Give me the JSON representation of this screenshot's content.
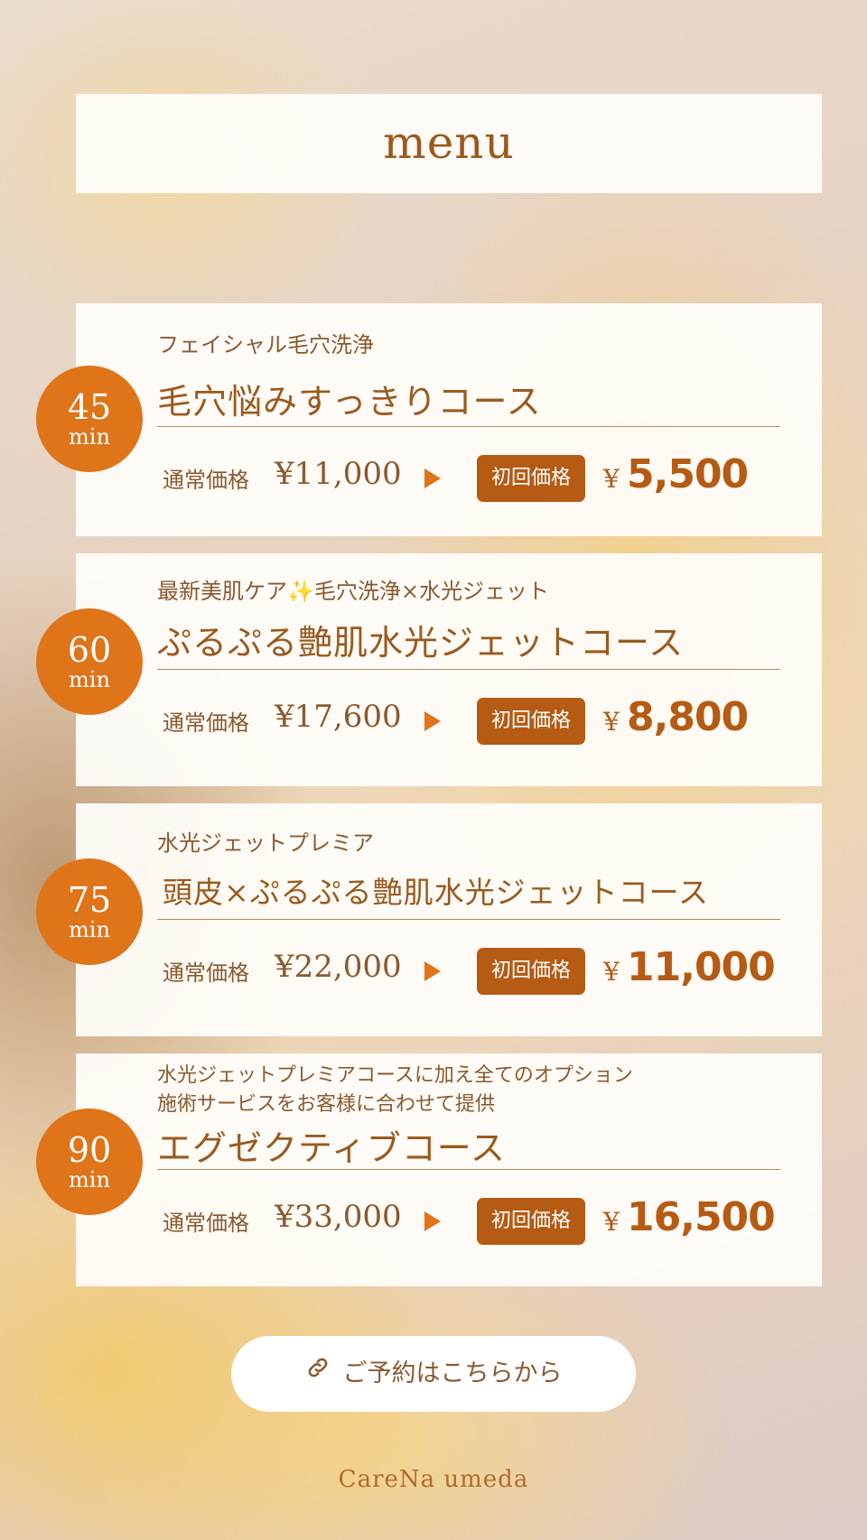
{
  "header": {
    "title": "menu"
  },
  "common": {
    "regular_label": "通常価格",
    "first_label": "初回価格",
    "yen": "¥"
  },
  "courses": [
    {
      "minutes": "45",
      "unit": "min",
      "subtitle": "フェイシャル毛穴洗浄",
      "name": "毛穴悩みすっきりコース",
      "regular_price": "¥11,000",
      "first_price": "5,500"
    },
    {
      "minutes": "60",
      "unit": "min",
      "subtitle": "最新美肌ケア✨毛穴洗浄×水光ジェット",
      "name": "ぷるぷる艶肌水光ジェットコース",
      "regular_price": "¥17,600",
      "first_price": "8,800"
    },
    {
      "minutes": "75",
      "unit": "min",
      "subtitle": "水光ジェットプレミア",
      "name": "頭皮×ぷるぷる艶肌水光ジェットコース",
      "regular_price": "¥22,000",
      "first_price": "11,000"
    },
    {
      "minutes": "90",
      "unit": "min",
      "subtitle": "水光ジェットプレミアコースに加え全てのオプション",
      "subtitle_line2": "施術サービスをお客様に合わせて提供",
      "name": "エグゼクティブコース",
      "regular_price": "¥33,000",
      "first_price": "16,500"
    }
  ],
  "reserve_button": {
    "label": "ご予約はこちらから",
    "icon": "link-icon"
  },
  "footer": {
    "brand": "CareNa umeda"
  },
  "colors": {
    "accent": "#df7419",
    "accent_dark": "#b55b14",
    "text_brown": "#8a5a30"
  }
}
